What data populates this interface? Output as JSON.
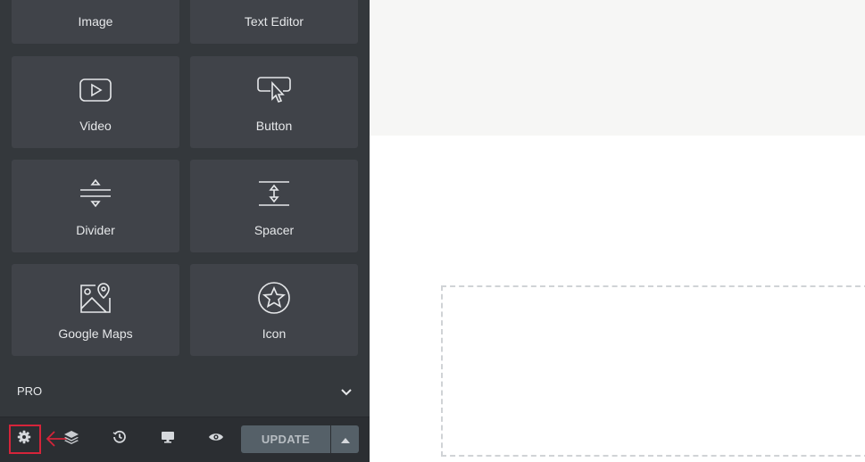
{
  "panel": {
    "widgets": [
      {
        "label": "Image",
        "icon": "image-icon"
      },
      {
        "label": "Text Editor",
        "icon": "text-editor-icon"
      },
      {
        "label": "Video",
        "icon": "video-icon"
      },
      {
        "label": "Button",
        "icon": "button-icon"
      },
      {
        "label": "Divider",
        "icon": "divider-icon"
      },
      {
        "label": "Spacer",
        "icon": "spacer-icon"
      },
      {
        "label": "Google Maps",
        "icon": "google-maps-icon"
      },
      {
        "label": "Icon",
        "icon": "star-icon"
      }
    ],
    "pro_section": {
      "label": "PRO"
    }
  },
  "footer": {
    "icons": [
      "gear-icon",
      "layers-icon",
      "history-icon",
      "desktop-icon",
      "eye-icon"
    ],
    "update_label": "UPDATE"
  },
  "colors": {
    "panel_bg": "#34383c",
    "widget_bg": "#404349",
    "footer_bg": "#2b2e32",
    "update_button": "#556068",
    "annotation": "#d5243a",
    "canvas_top": "#f6f6f5"
  }
}
